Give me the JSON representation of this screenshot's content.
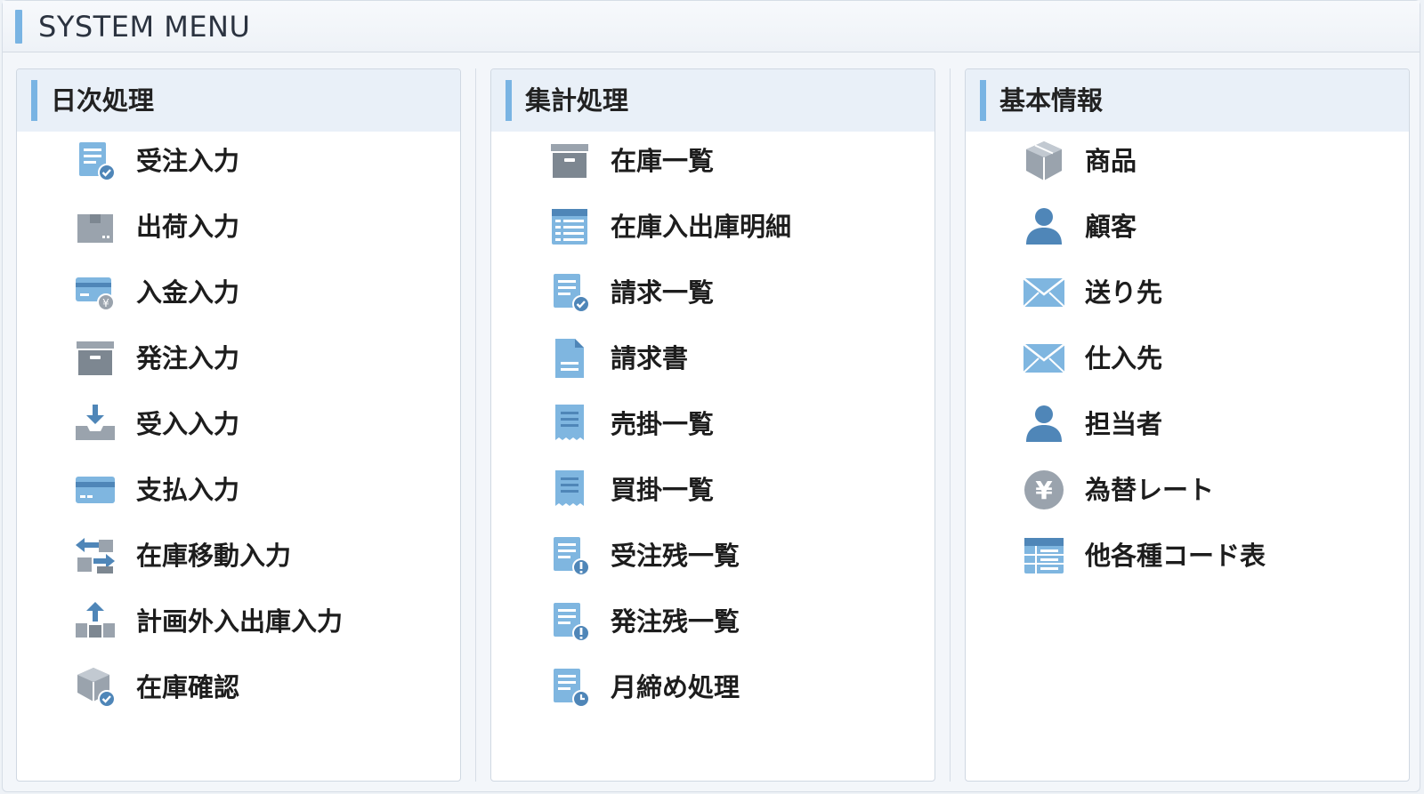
{
  "app": {
    "title": "SYSTEM MENU"
  },
  "panels": [
    {
      "title": "日次処理",
      "items": [
        {
          "label": "受注入力",
          "icon": "order-entry-icon"
        },
        {
          "label": "出荷入力",
          "icon": "shipping-box-icon"
        },
        {
          "label": "入金入力",
          "icon": "payment-card-yen-icon"
        },
        {
          "label": "発注入力",
          "icon": "archive-box-icon"
        },
        {
          "label": "受入入力",
          "icon": "inbox-download-icon"
        },
        {
          "label": "支払入力",
          "icon": "credit-card-icon"
        },
        {
          "label": "在庫移動入力",
          "icon": "transfer-arrows-icon"
        },
        {
          "label": "計画外入出庫入力",
          "icon": "boxes-upload-icon"
        },
        {
          "label": "在庫確認",
          "icon": "package-check-icon"
        }
      ]
    },
    {
      "title": "集計処理",
      "items": [
        {
          "label": "在庫一覧",
          "icon": "archive-box-icon"
        },
        {
          "label": "在庫入出庫明細",
          "icon": "table-list-icon"
        },
        {
          "label": "請求一覧",
          "icon": "document-check-icon"
        },
        {
          "label": "請求書",
          "icon": "document-icon"
        },
        {
          "label": "売掛一覧",
          "icon": "receipt-icon"
        },
        {
          "label": "買掛一覧",
          "icon": "receipt-icon"
        },
        {
          "label": "受注残一覧",
          "icon": "document-alert-icon"
        },
        {
          "label": "発注残一覧",
          "icon": "document-alert-icon"
        },
        {
          "label": "月締め処理",
          "icon": "document-clock-icon"
        }
      ]
    },
    {
      "title": "基本情報",
      "items": [
        {
          "label": "商品",
          "icon": "package-icon"
        },
        {
          "label": "顧客",
          "icon": "person-icon"
        },
        {
          "label": "送り先",
          "icon": "envelope-icon"
        },
        {
          "label": "仕入先",
          "icon": "envelope-icon"
        },
        {
          "label": "担当者",
          "icon": "person-icon"
        },
        {
          "label": "為替レート",
          "icon": "yen-coin-icon"
        },
        {
          "label": "他各種コード表",
          "icon": "code-table-icon"
        }
      ]
    }
  ]
}
